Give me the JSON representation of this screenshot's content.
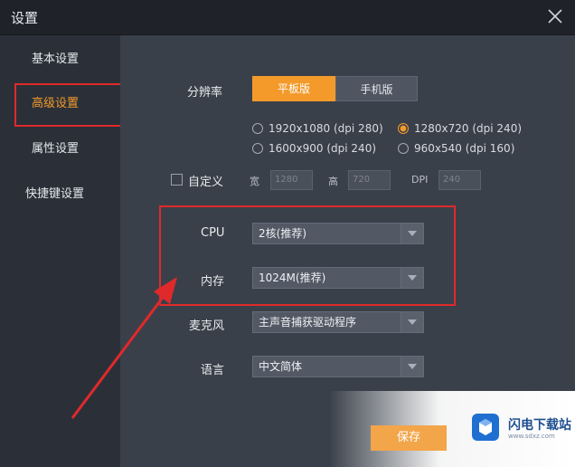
{
  "window": {
    "title": "设置"
  },
  "sidebar": {
    "items": [
      {
        "label": "基本设置",
        "active": false
      },
      {
        "label": "高级设置",
        "active": true
      },
      {
        "label": "属性设置",
        "active": false
      },
      {
        "label": "快捷键设置",
        "active": false
      }
    ]
  },
  "resolution": {
    "label": "分辨率",
    "modes": [
      {
        "label": "平板版",
        "selected": true
      },
      {
        "label": "手机版",
        "selected": false
      }
    ],
    "options": [
      {
        "label": "1920x1080 (dpi 280)",
        "selected": false
      },
      {
        "label": "1280x720 (dpi 240)",
        "selected": true
      },
      {
        "label": "1600x900 (dpi 240)",
        "selected": false
      },
      {
        "label": "960x540 (dpi 160)",
        "selected": false
      }
    ],
    "custom": {
      "label": "自定义",
      "checked": false,
      "width_label": "宽",
      "width_value": "1280",
      "height_label": "高",
      "height_value": "720",
      "dpi_label": "DPI",
      "dpi_value": "240"
    }
  },
  "cpu": {
    "label": "CPU",
    "value": "2核(推荐)"
  },
  "memory": {
    "label": "内存",
    "value": "1024M(推荐)"
  },
  "microphone": {
    "label": "麦克风",
    "value": "主声音捕获驱动程序"
  },
  "language": {
    "label": "语言",
    "value": "中文简体"
  },
  "footer": {
    "save_label": "保存"
  },
  "watermark": {
    "name": "闪电下载站",
    "url": "www.sdxz.com"
  },
  "colors": {
    "accent": "#f39a2b",
    "highlight": "#e0292b",
    "background": "#3a404a"
  }
}
